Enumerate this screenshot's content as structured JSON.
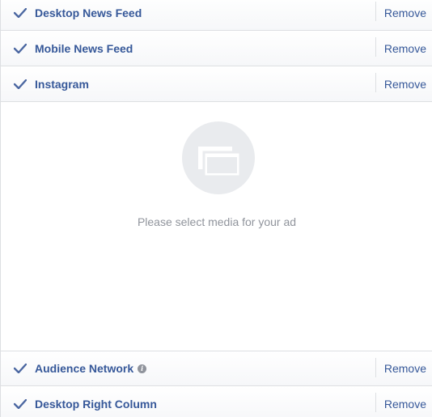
{
  "placements_top": [
    {
      "label": "Desktop News Feed",
      "action": "Remove"
    },
    {
      "label": "Mobile News Feed",
      "action": "Remove"
    },
    {
      "label": "Instagram",
      "action": "Remove"
    }
  ],
  "empty_state": {
    "icon": "media-placeholder-icon",
    "message": "Please select media for your ad"
  },
  "placements_bottom": [
    {
      "label": "Audience Network",
      "has_info": true,
      "action": "Remove"
    },
    {
      "label": "Desktop Right Column",
      "action": "Remove"
    }
  ],
  "colors": {
    "link": "#365899",
    "muted": "#90949c",
    "border": "#dddfe2",
    "check": "#4b67a1"
  }
}
